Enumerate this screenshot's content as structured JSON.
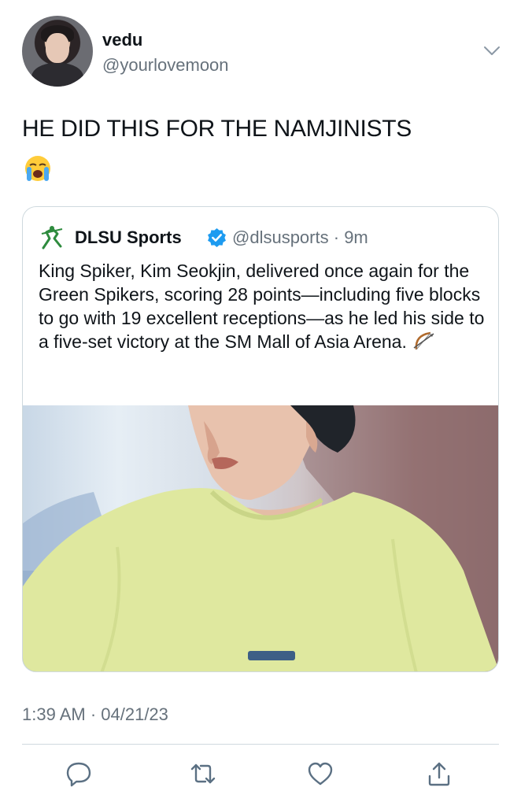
{
  "author": {
    "display_name": "vedu",
    "handle": "@yourlovemoon",
    "avatar_icon": "profile-photo"
  },
  "tweet": {
    "text": "HE DID THIS FOR THE NAMJINISTS",
    "emoji": "loudly-crying-face"
  },
  "quoted_tweet": {
    "display_name": "DLSU Sports",
    "verified": true,
    "handle": "@dlsusports",
    "separator": "·",
    "age": "9m",
    "text": "King Spiker, Kim Seokjin, delivered once again for the Green Spikers, scoring 28 points—including five blocks to go with 19 excellent receptions—as he led his side to a five-set victory at the SM Mall of Asia Arena.",
    "emoji": "bow-and-arrow",
    "logo_icon": "green-archer-logo",
    "image": "photo-person-yellow-shirt"
  },
  "meta": {
    "timestamp": "1:39 AM · 04/21/23"
  },
  "actions": [
    {
      "name": "reply",
      "icon": "reply-icon"
    },
    {
      "name": "retweet",
      "icon": "retweet-icon"
    },
    {
      "name": "like",
      "icon": "heart-icon"
    },
    {
      "name": "share",
      "icon": "share-icon"
    }
  ],
  "colors": {
    "text": "#0f1419",
    "secondary": "#66717b",
    "border": "#cfd9de",
    "verified": "#1d9bf0",
    "logo_green": "#2e8b3e"
  }
}
